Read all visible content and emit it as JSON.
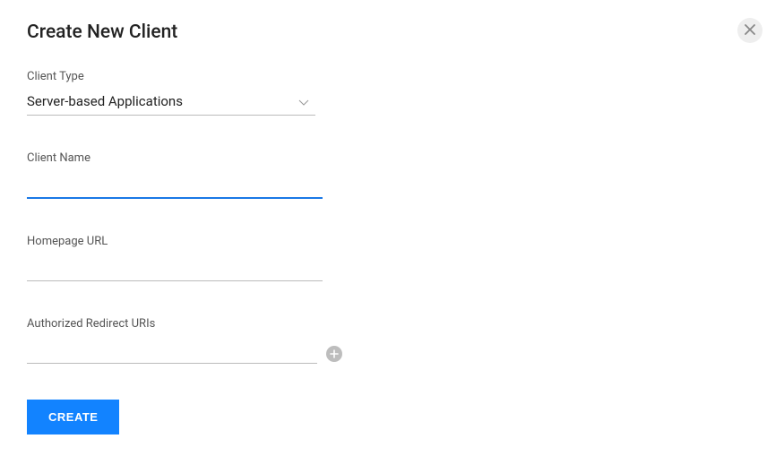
{
  "title": "Create New Client",
  "fields": {
    "client_type": {
      "label": "Client Type",
      "value": "Server-based Applications"
    },
    "client_name": {
      "label": "Client Name",
      "value": ""
    },
    "homepage_url": {
      "label": "Homepage URL",
      "value": ""
    },
    "redirect_uris": {
      "label": "Authorized Redirect URIs",
      "value": ""
    }
  },
  "actions": {
    "create_label": "CREATE"
  }
}
